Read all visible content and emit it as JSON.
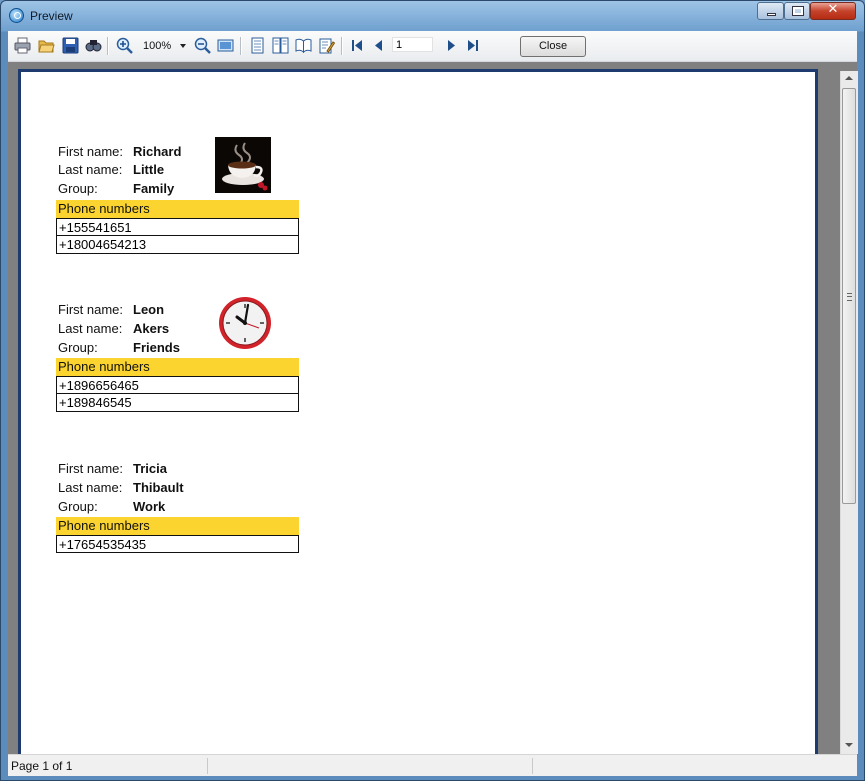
{
  "window": {
    "title": "Preview"
  },
  "toolbar": {
    "icons": [
      "print-icon",
      "open-folder-icon",
      "save-icon",
      "find-icon",
      "zoom-in-icon",
      "zoom-out-icon",
      "fit-page-icon",
      "single-page-icon",
      "two-page-icon",
      "book-icon",
      "edit-icon",
      "first-page-icon",
      "prev-page-icon",
      "next-page-icon",
      "last-page-icon"
    ],
    "zoom": "100%",
    "page": "1",
    "close_label": "Close"
  },
  "contacts": [
    {
      "first_label": "First name:",
      "first": "Richard",
      "last_label": "Last name:",
      "last": "Little",
      "group_label": "Group:",
      "group": "Family",
      "photo": "coffee-cup-icon",
      "phones_header": "Phone numbers",
      "phones": [
        "+155541651",
        "+18004654213"
      ]
    },
    {
      "first_label": "First name:",
      "first": "Leon",
      "last_label": "Last name:",
      "last": "Akers",
      "group_label": "Group:",
      "group": "Friends",
      "photo": "clock-icon",
      "phones_header": "Phone numbers",
      "phones": [
        "+1896656465",
        "+189846545"
      ]
    },
    {
      "first_label": "First name:",
      "first": "Tricia",
      "last_label": "Last name:",
      "last": "Thibault",
      "group_label": "Group:",
      "group": "Work",
      "photo": "",
      "phones_header": "Phone numbers",
      "phones": [
        "+17654535435"
      ]
    }
  ],
  "status": {
    "text": "Page 1 of 1"
  },
  "colors": {
    "header_fill": "#fcd42f",
    "page_border": "#1d3b6e",
    "background": "#808080"
  }
}
